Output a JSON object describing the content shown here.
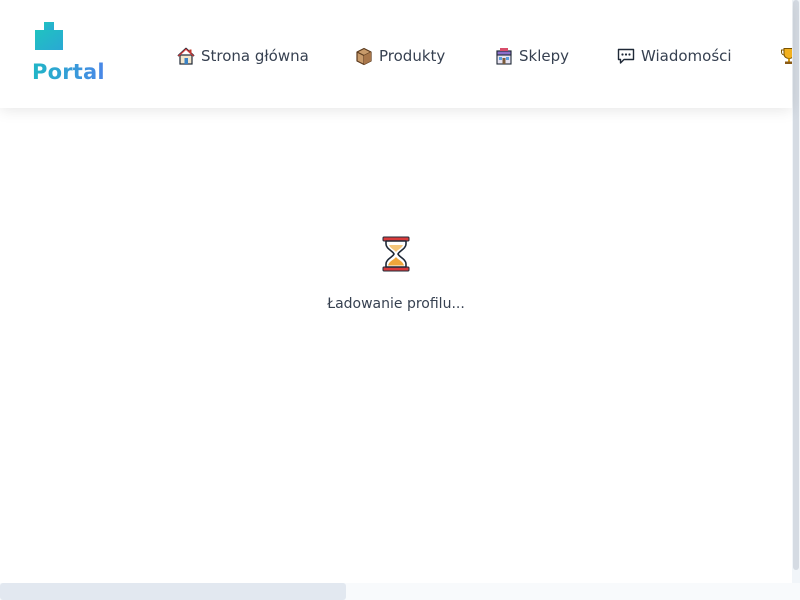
{
  "brand": {
    "name": "Portal",
    "logo_icon": "logo-blocks-icon",
    "gradient": [
      "#1fb6c6",
      "#4a86e8"
    ]
  },
  "nav": {
    "items": [
      {
        "label": "Strona główna",
        "icon": "house-icon"
      },
      {
        "label": "Produkty",
        "icon": "package-icon"
      },
      {
        "label": "Sklepy",
        "icon": "store-icon"
      },
      {
        "label": "Wiadomości",
        "icon": "speech-bubble-icon"
      },
      {
        "label": "",
        "icon": "trophy-icon"
      }
    ]
  },
  "main": {
    "loading_icon": "hourglass-icon",
    "loading_text": "Ładowanie profilu..."
  },
  "colors": {
    "text": "#374151",
    "header_bg": "#ffffff",
    "scroll_track": "#f1f5f9",
    "scroll_thumb": "#e2e8f0"
  }
}
